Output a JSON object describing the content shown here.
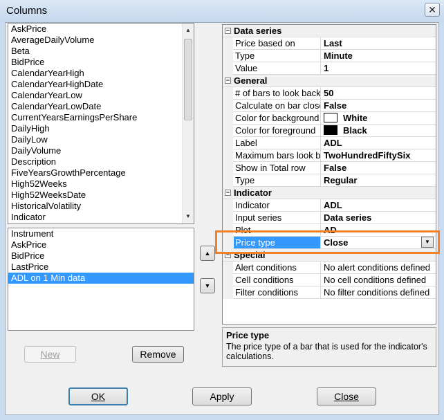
{
  "window": {
    "title": "Columns",
    "close_glyph": "✕"
  },
  "available_columns": [
    "AskPrice",
    "AverageDailyVolume",
    "Beta",
    "BidPrice",
    "CalendarYearHigh",
    "CalendarYearHighDate",
    "CalendarYearLow",
    "CalendarYearLowDate",
    "CurrentYearsEarningsPerShare",
    "DailyHigh",
    "DailyLow",
    "DailyVolume",
    "Description",
    "FiveYearsGrowthPercentage",
    "High52Weeks",
    "High52WeeksDate",
    "HistoricalVolatility",
    "Indicator"
  ],
  "selected_columns": [
    "Instrument",
    "AskPrice",
    "BidPrice",
    "LastPrice",
    "ADL on 1 Min data"
  ],
  "selected_columns_active_index": 4,
  "buttons": {
    "new": "New",
    "remove": "Remove",
    "ok": "OK",
    "apply": "Apply",
    "close": "Close",
    "move_up": "▲",
    "move_down": "▼"
  },
  "properties": [
    {
      "category": "Data series",
      "expander": "−"
    },
    {
      "name": "Price based on",
      "value": "Last"
    },
    {
      "name": "Type",
      "value": "Minute"
    },
    {
      "name": "Value",
      "value": "1"
    },
    {
      "category": "General",
      "expander": "−"
    },
    {
      "name": "# of bars to look back",
      "value": "50"
    },
    {
      "name": "Calculate on bar close",
      "value": "False"
    },
    {
      "name": "Color for background",
      "value": "White",
      "swatch": "#ffffff"
    },
    {
      "name": "Color for foreground",
      "value": "Black",
      "swatch": "#000000"
    },
    {
      "name": "Label",
      "value": "ADL"
    },
    {
      "name": "Maximum bars look back",
      "value": "TwoHundredFiftySix"
    },
    {
      "name": "Show in Total row",
      "value": "False"
    },
    {
      "name": "Type",
      "value": "Regular"
    },
    {
      "category": "Indicator",
      "expander": "−"
    },
    {
      "name": "Indicator",
      "value": "ADL"
    },
    {
      "name": "Input series",
      "value": "Data series"
    },
    {
      "name": "Plot",
      "value": "AD"
    },
    {
      "name": "Price type",
      "value": "Close",
      "selected": true,
      "dropdown": true
    },
    {
      "category": "Special",
      "expander": "−"
    },
    {
      "name": "Alert conditions",
      "value": "No alert conditions defined",
      "plain": true
    },
    {
      "name": "Cell conditions",
      "value": "No cell conditions defined",
      "plain": true
    },
    {
      "name": "Filter conditions",
      "value": "No filter conditions defined",
      "plain": true
    }
  ],
  "help": {
    "title": "Price type",
    "text": "The price type of a bar that is used for the indicator's calculations."
  },
  "colors": {
    "selection": "#3399ff",
    "highlight_box": "#f28026"
  }
}
